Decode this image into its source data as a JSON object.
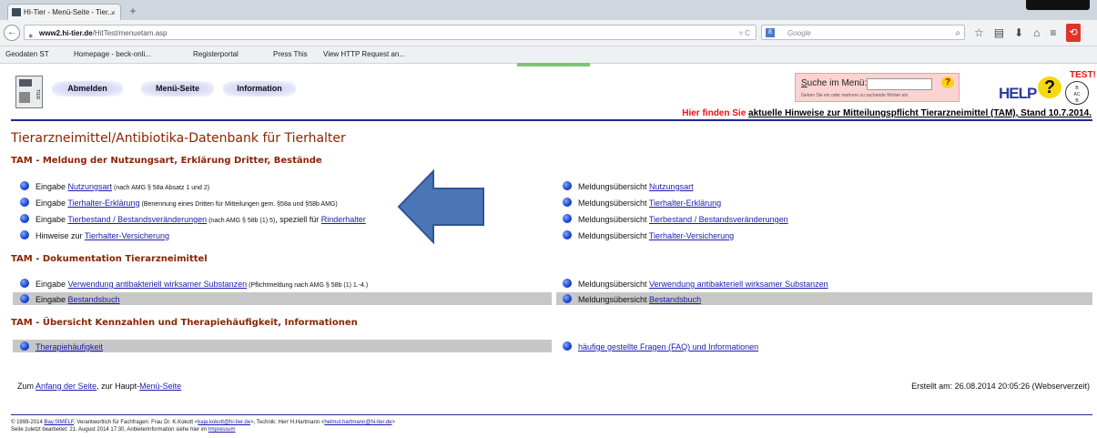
{
  "browser": {
    "tab_title": "HI-Tier - Menü-Seite - Tier...",
    "tab_close": "×",
    "new_tab": "+",
    "url_domain": "www2.hi-tier.de",
    "url_path": "/HitTest/menuetam.asp",
    "url_controls": "▿ C",
    "search_engine_badge": "8",
    "search_placeholder": "Google",
    "search_glass": "⌕",
    "toolbar_icons": [
      "☆",
      "▤",
      "⬇",
      "⌂",
      "≡",
      "⟲"
    ],
    "bookmarks": [
      "Geodaten ST",
      "Homepage - beck-onli...",
      "Registerportal",
      "Press This",
      "View HTTP Request an..."
    ]
  },
  "header": {
    "nav_buttons": [
      "Abmelden",
      "Menü-Seite",
      "Information"
    ],
    "search_label_prefix": "S",
    "search_label_rest": "uche im Menü:",
    "search_hint": "Geben Sie ein oder mehrere zu suchende Wörter ein.",
    "search_help": "?",
    "test_badge": "TEST!",
    "help_text": "HELP",
    "help_q": "?",
    "tam_notice_red": "Hier finden Sie",
    "tam_notice_link": "aktuelle Hinweise zur Mitteilungspflicht Tierarzneimittel (TAM), Stand 10.7.2014."
  },
  "main": {
    "title": "Tierarzneimittel/Antibiotika-Datenbank für Tierhalter",
    "sections": [
      "TAM - Meldung der Nutzungsart, Erklärung Dritter, Bestände",
      "TAM - Dokumentation Tierarzneimittel",
      "TAM - Übersicht Kennzahlen und Therapiehäufigkeit, Informationen"
    ],
    "left_items": [
      {
        "pre": "Eingabe ",
        "link": "Nutzungsart",
        "note": " (nach AMG § 58a Absatz 1 und 2)"
      },
      {
        "pre": "Eingabe ",
        "link": "Tierhalter-Erklärung",
        "note": " (Benennung eines Dritten für Mitteilungen gem. §58a und §58b AMG)"
      },
      {
        "pre": "Eingabe ",
        "link": "Tierbestand / Bestandsveränderungen",
        "note": " (nach AMG § 58b (1) 5)",
        "post": ", speziell für ",
        "link2": "Rinderhalter"
      },
      {
        "pre": "Hinweise zur ",
        "link": "Tierhalter-Versicherung"
      },
      {
        "pre": "Eingabe ",
        "link": "Verwendung antibakteriell wirksamer Substanzen",
        "note": " (Pflichtmeldung nach AMG § 58b (1) 1.-4.)"
      },
      {
        "pre": "Eingabe ",
        "link": "Bestandsbuch"
      },
      {
        "pre": "",
        "link": "Therapiehäufigkeit"
      }
    ],
    "right_items": [
      {
        "pre": "Meldungsübersicht ",
        "link": "Nutzungsart"
      },
      {
        "pre": "Meldungsübersicht ",
        "link": "Tierhalter-Erklärung"
      },
      {
        "pre": "Meldungsübersicht ",
        "link": "Tierbestand / Bestandsveränderungen"
      },
      {
        "pre": "Meldungsübersicht ",
        "link": "Tierhalter-Versicherung"
      },
      {
        "pre": "Meldungsübersicht ",
        "link": "Verwendung antibakteriell wirksamer Substanzen"
      },
      {
        "pre": "Meldungsübersicht ",
        "link": "Bestandsbuch"
      },
      {
        "pre": "",
        "link": "häufige gestellte Fragen (FAQ) und Informationen"
      }
    ]
  },
  "bottom": {
    "zum": "Zum ",
    "anfang_link": "Anfang der Seite",
    "sep": ",   zur Haupt-",
    "menu_link": "Menü-Seite",
    "created": "Erstellt am: 26.08.2014 20:05:26 (Webserverzeit)"
  },
  "footer": {
    "line1_pre": "© 1999-2014 ",
    "stmelf": "Bay.StMELF",
    "line1_mid": ", Verantwortlich für Fachfragen: Frau Dr. K.Kokott <",
    "kokott_mail": "kaja.kokott@hi-tier.de",
    "line1_mid2": ">, Technik: Herr H.Hartmann <",
    "hartmann_mail": "helmut.hartmann@hi-tier.de",
    "line1_end": ">",
    "line2_pre": "Seite zuletzt bearbeitet: 21. August 2014 17:30, Anbieterinformation siehe hier im ",
    "impressum": "Impressum"
  },
  "colors": {
    "heading": "#8b2500",
    "link": "#1a1ab0",
    "rule": "#1c2a8f",
    "arrow": "#4a76b8"
  }
}
